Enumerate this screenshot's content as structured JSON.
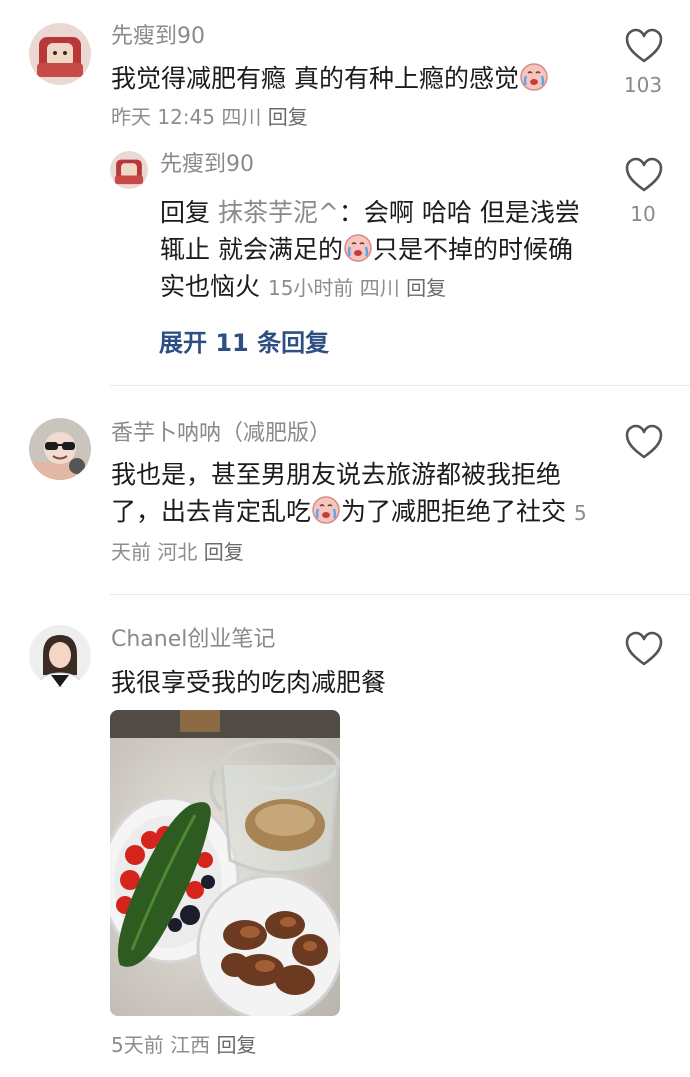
{
  "comments": [
    {
      "username": "先瘦到90",
      "text": "我觉得减肥有瘾 真的有种上瘾的感觉",
      "emoji": "crying-emoji",
      "time": "昨天 12:45",
      "location": "四川",
      "reply_label": "回复",
      "likes": "103",
      "replies": [
        {
          "username": "先瘦到90",
          "prefix": "回复",
          "reply_to": "抹茶芋泥^",
          "text_part1": "：会啊 哈哈 但是浅尝辄止 就会满足的",
          "text_part2": "只是不掉的时候确实也恼火",
          "emoji": "crying-emoji",
          "time": "15小时前",
          "location": "四川",
          "reply_label": "回复",
          "likes": "10"
        }
      ],
      "expand_label": "展开 11 条回复"
    },
    {
      "username": "香芋卜呐呐（减肥版）",
      "text_part1": "我也是，甚至男朋友说去旅游都被我拒绝了，出去肯定乱吃",
      "text_part2": "为了减肥拒绝了社交",
      "emoji": "crying-emoji",
      "time": "5天前",
      "location": "河北",
      "reply_label": "回复"
    },
    {
      "username": "Chanel创业笔记",
      "text": "我很享受我的吃肉减肥餐",
      "image": "food-photo",
      "time": "5天前",
      "location": "江西",
      "reply_label": "回复"
    }
  ],
  "colors": {
    "username": "#8a8a8a",
    "expand_link": "#2f4f83",
    "divider": "#e8e8e8"
  }
}
